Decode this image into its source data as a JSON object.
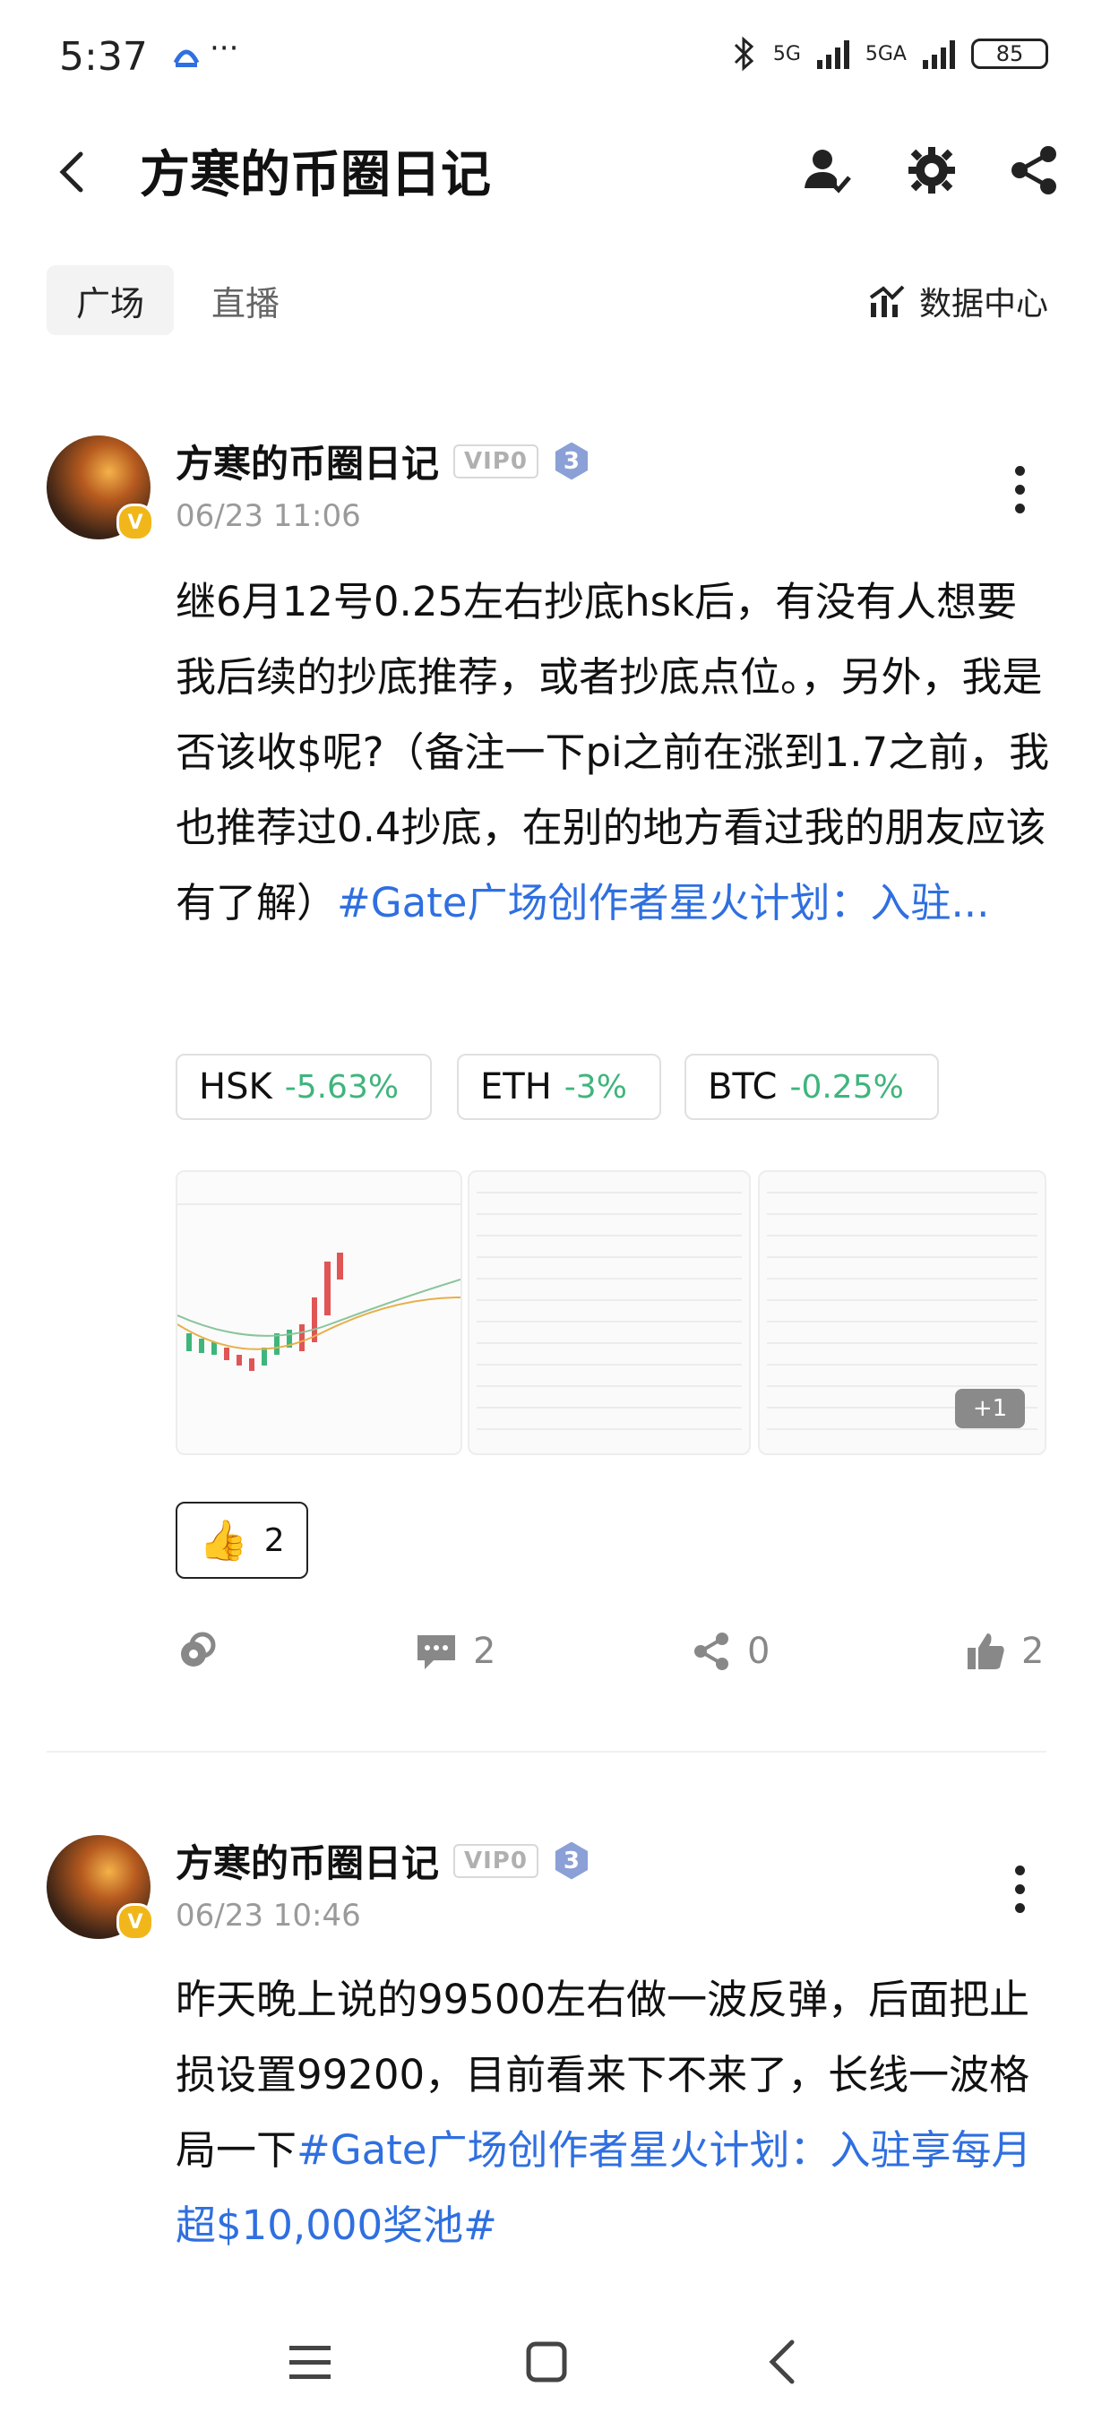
{
  "status_bar": {
    "time": "5:37",
    "dots": "···",
    "net1": "5G",
    "net2": "5GA",
    "battery": "85"
  },
  "header": {
    "title": "方寒的币圈日记",
    "icons": [
      "back-arrow-icon",
      "user-follow-icon",
      "gear-icon",
      "share-icon"
    ]
  },
  "tabs": {
    "items": [
      "广场",
      "直播"
    ],
    "active": "广场",
    "data_center": "数据中心"
  },
  "posts": [
    {
      "author": "方寒的币圈日记",
      "vip": "VIP0",
      "level": "3",
      "verified": "V",
      "date": "06/23 11:06",
      "text": "继6月12号0.25左右抄底hsk后，有没有人想要我后续的抄底推荐，或者抄底点位。，另外，我是否该收$呢?（备注一下pi之前在涨到1.7之前，我也推荐过0.4抄底，在别的地方看过我的朋友应该有了解）",
      "tag": "#Gate广场创作者星火计划：入驻...",
      "chips": [
        {
          "symbol": "HSK",
          "change": "-5.63%"
        },
        {
          "symbol": "ETH",
          "change": "-3%"
        },
        {
          "symbol": "BTC",
          "change": "-0.25%"
        }
      ],
      "images_more": "+1",
      "reaction": {
        "emoji": "👍",
        "count": "2"
      },
      "actions": {
        "comments": "2",
        "shares": "0",
        "likes": "2"
      }
    },
    {
      "author": "方寒的币圈日记",
      "vip": "VIP0",
      "level": "3",
      "verified": "V",
      "date": "06/23 10:46",
      "text": "昨天晚上说的99500左右做一波反弹，后面把止损设置99200，目前看来下不来了，长线一波格局一下",
      "tag": "#Gate广场创作者星火计划：入驻享每月超$10,000奖池#"
    }
  ],
  "colors": {
    "accent": "#2f6fe0",
    "positive_change": "#3fb57c",
    "level_badge": "#8ba0d6",
    "verified_badge": "#f1b71a"
  }
}
